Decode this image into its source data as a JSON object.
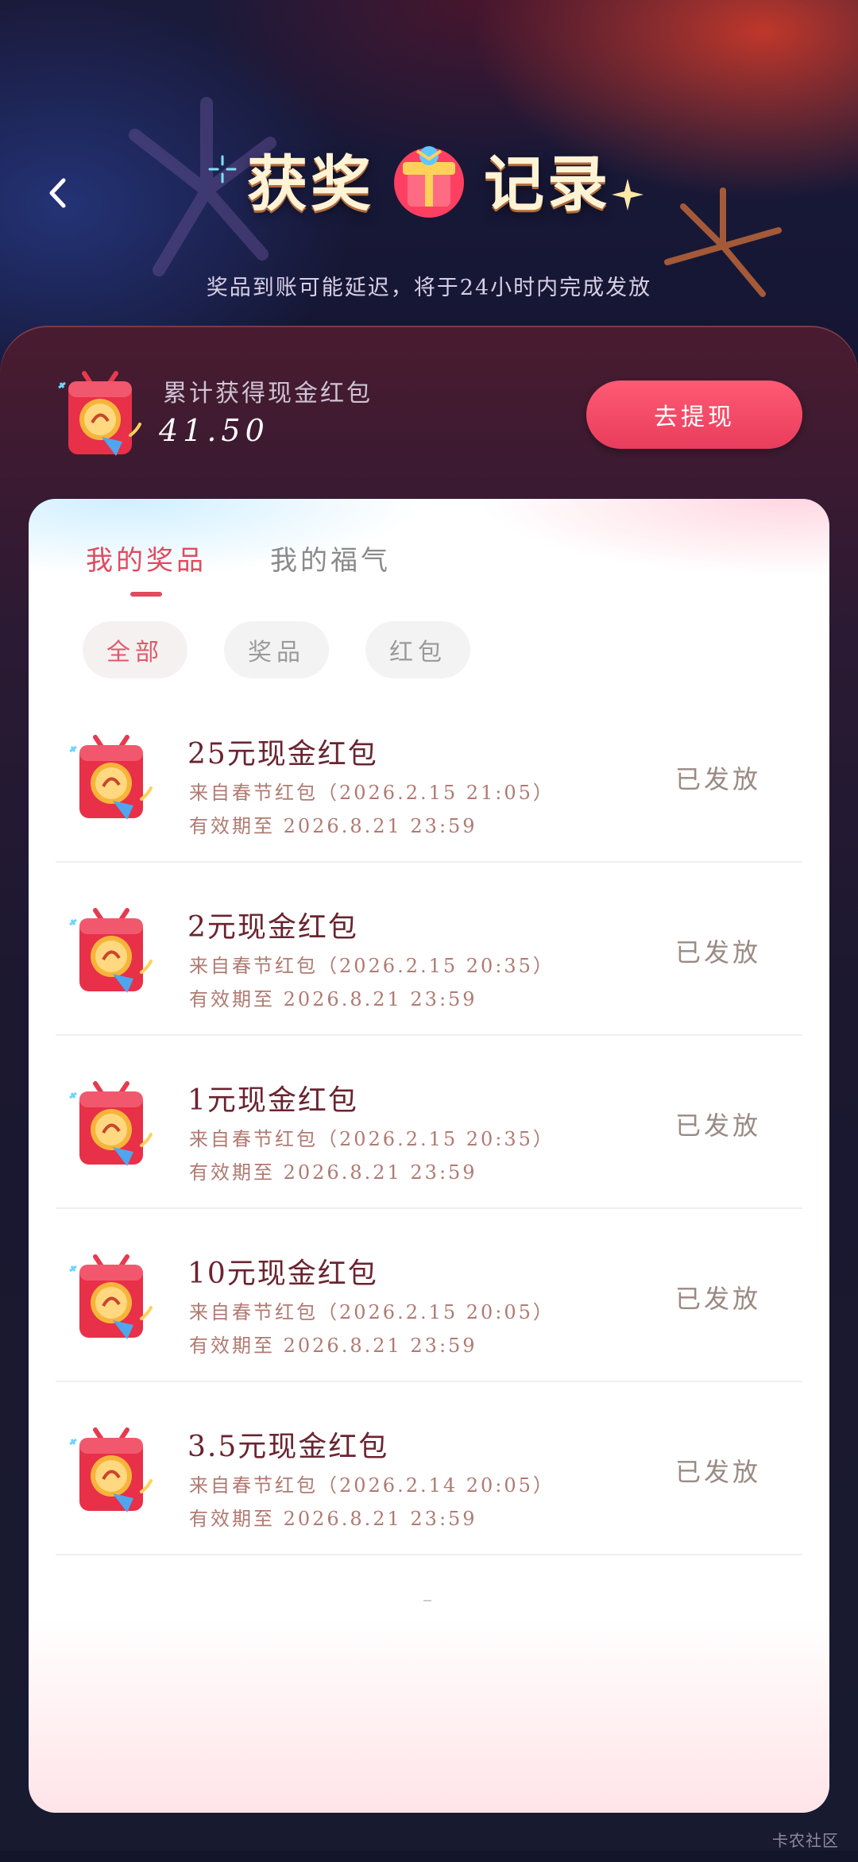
{
  "header": {
    "title_left": "获奖",
    "title_right": "记录",
    "subtitle": "奖品到账可能延迟，将于24小时内完成发放"
  },
  "summary": {
    "label": "累计获得现金红包",
    "amount": "41.50",
    "withdraw_label": "去提现"
  },
  "tabs": [
    {
      "label": "我的奖品",
      "active": true
    },
    {
      "label": "我的福气",
      "active": false
    }
  ],
  "filters": [
    {
      "label": "全部",
      "active": true
    },
    {
      "label": "奖品",
      "active": false
    },
    {
      "label": "红包",
      "active": false
    }
  ],
  "records": [
    {
      "title": "25元现金红包",
      "source": "来自春节红包（2026.2.15 21:05）",
      "expire": "有效期至 2026.8.21 23:59",
      "status": "已发放"
    },
    {
      "title": "2元现金红包",
      "source": "来自春节红包（2026.2.15 20:35）",
      "expire": "有效期至 2026.8.21 23:59",
      "status": "已发放"
    },
    {
      "title": "1元现金红包",
      "source": "来自春节红包（2026.2.15 20:35）",
      "expire": "有效期至 2026.8.21 23:59",
      "status": "已发放"
    },
    {
      "title": "10元现金红包",
      "source": "来自春节红包（2026.2.15 20:05）",
      "expire": "有效期至 2026.8.21 23:59",
      "status": "已发放"
    },
    {
      "title": "3.5元现金红包",
      "source": "来自春节红包（2026.2.14 20:05）",
      "expire": "有效期至 2026.8.21 23:59",
      "status": "已发放"
    }
  ],
  "watermark": "卡农社区",
  "colors": {
    "accent": "#e24a5e",
    "button": "#e83d5c",
    "title_text": "#fff3d6"
  },
  "icons": {
    "back": "chevron-left-icon",
    "red_envelope": "red-envelope-icon",
    "gift": "gift-box-icon"
  }
}
